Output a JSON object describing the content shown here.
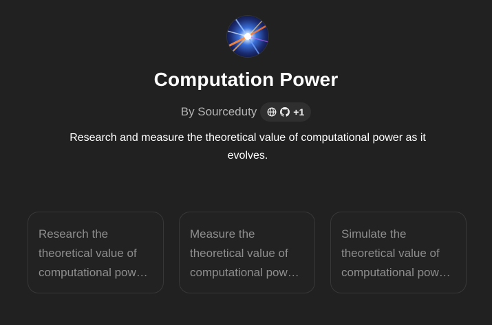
{
  "gpt": {
    "avatar_icon": "light-tunnel-image",
    "title": "Computation Power",
    "author": "By Sourceduty",
    "links": {
      "icons": [
        "globe-icon",
        "github-icon"
      ],
      "more_label": "+1"
    },
    "description": "Research and measure the theoretical value of computational power as it evolves."
  },
  "conversation_starters": [
    {
      "text": "Research the theoretical value of computational power as it evolves."
    },
    {
      "text": "Measure the theoretical value of computational power as it evolves."
    },
    {
      "text": "Simulate the theoretical value of computational power as it evolves."
    }
  ],
  "colors": {
    "background": "#212121",
    "card_border": "#383838",
    "pill_background": "#2f2f2f",
    "muted_text": "#8e8e8e"
  }
}
